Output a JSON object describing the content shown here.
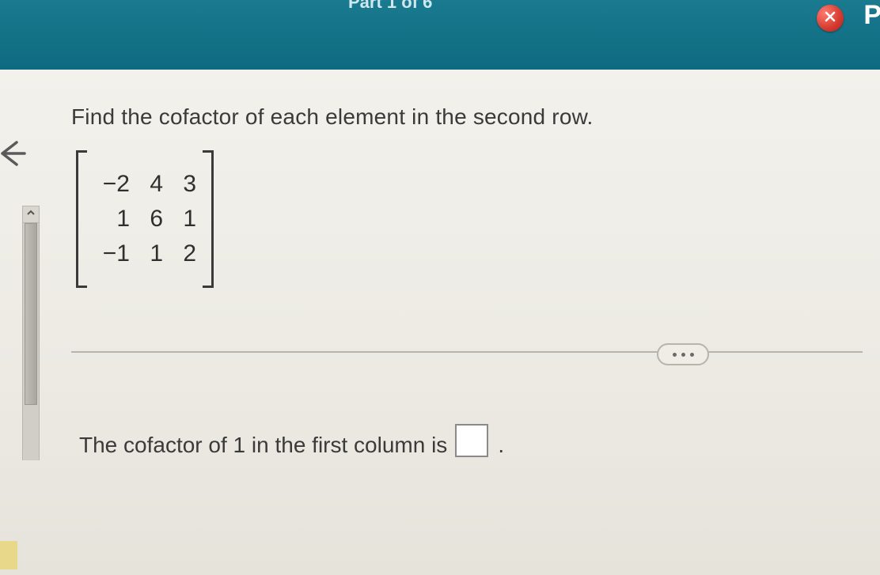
{
  "topbar": {
    "part_label": "Part 1 of 6",
    "right_letter": "P"
  },
  "question": {
    "prompt": "Find the cofactor of each element in the second row.",
    "matrix": {
      "r1": {
        "c1": "−2",
        "c2": "4",
        "c3": "3"
      },
      "r2": {
        "c1": "1",
        "c2": "6",
        "c3": "1"
      },
      "r3": {
        "c1": "−1",
        "c2": "1",
        "c3": "2"
      }
    },
    "answer_prefix": "The cofactor of 1 in the first column is",
    "answer_value": "",
    "answer_suffix": "."
  }
}
